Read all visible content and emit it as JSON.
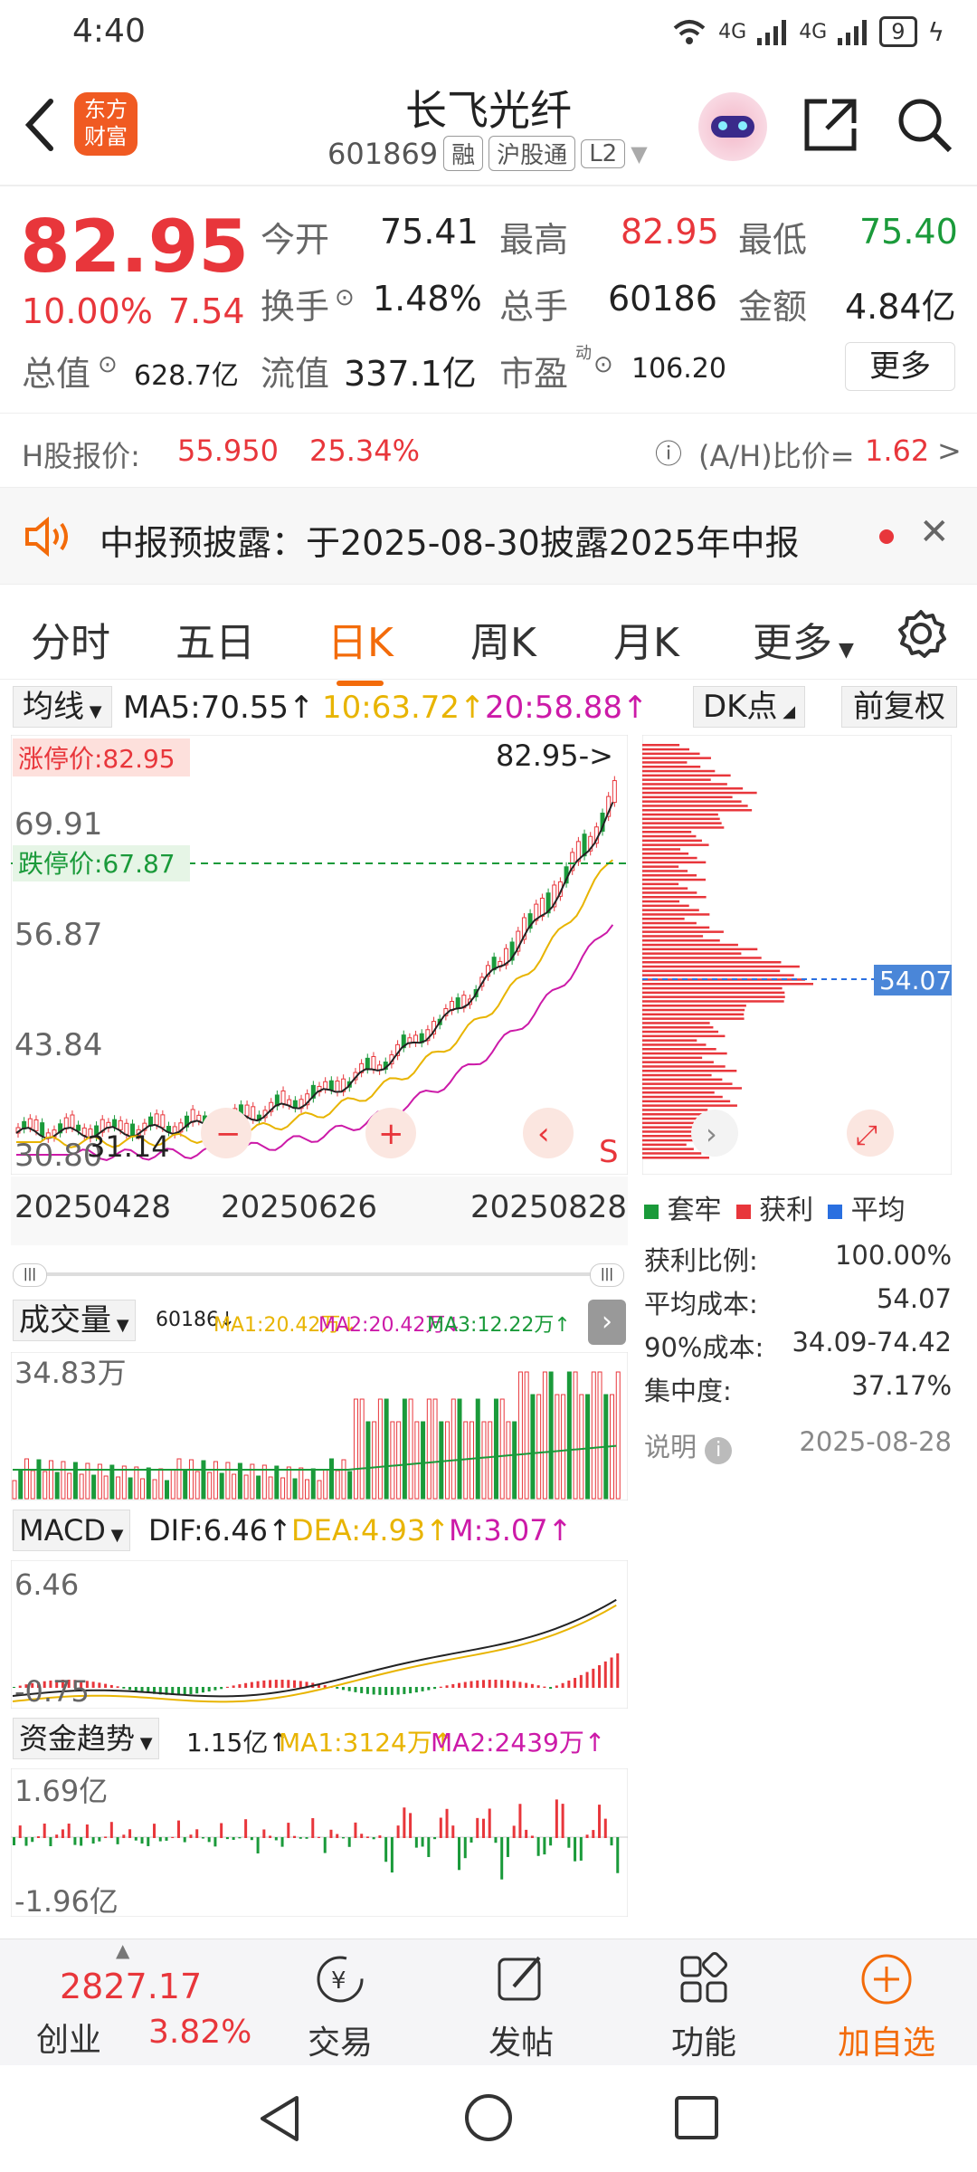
{
  "status_bar": {
    "time": "4:40",
    "net1": "4G",
    "net2": "4G",
    "battery": "9"
  },
  "header": {
    "title": "长飞光纤",
    "code": "601869",
    "tags": [
      "融",
      "沪股通",
      "L2"
    ],
    "logo_text": "东方财富"
  },
  "quote": {
    "price": "82.95",
    "change_pct": "10.00%",
    "change": "7.54",
    "open_label": "今开",
    "open": "75.41",
    "high_label": "最高",
    "high": "82.95",
    "low_label": "最低",
    "low": "75.40",
    "turnover_label": "换手",
    "turnover": "1.48%",
    "volume_label": "总手",
    "volume": "60186",
    "amount_label": "金额",
    "amount": "4.84亿",
    "mktcap_label": "总值",
    "mktcap": "628.7亿",
    "float_label": "流值",
    "float": "337.1亿",
    "pe_label": "市盈",
    "pe_sup": "动",
    "pe": "106.20",
    "more_label": "更多"
  },
  "h_share": {
    "label": "H股报价:",
    "price": "55.950",
    "pct": "25.34%",
    "ah_label": "(A/H)比价=",
    "ah": "1.62",
    "arrow": ">"
  },
  "notice": {
    "text": "中报预披露：于2025-08-30披露2025年中报",
    "close": "✕"
  },
  "tabs": [
    "分时",
    "五日",
    "日K",
    "周K",
    "月K",
    "更多"
  ],
  "active_tab": 2,
  "kline": {
    "indicator_label": "均线",
    "ma5": "MA5:70.55↑",
    "ma10": "10:63.72↑",
    "ma20": "20:58.88↑",
    "dk_label": "DK点",
    "adjust_label": "前复权",
    "limit_up": "涨停价:82.95",
    "limit_down": "跌停价:67.87",
    "last_price_tag": "82.95->",
    "y_labels": [
      "69.91",
      "56.87",
      "43.84",
      "30.80"
    ],
    "low_marker": "31.14",
    "x_labels": [
      "20250428",
      "20250626",
      "20250828"
    ],
    "cost_line": "54.07",
    "s_marker": "S"
  },
  "chip": {
    "legend": [
      "套牢",
      "获利",
      "平均"
    ],
    "rows": [
      {
        "label": "获利比例:",
        "value": "100.00%"
      },
      {
        "label": "平均成本:",
        "value": "54.07"
      },
      {
        "label": "90%成本:",
        "value": "34.09-74.42"
      },
      {
        "label": "集中度:",
        "value": "37.17%"
      }
    ],
    "note_label": "说明",
    "date": "2025-08-28"
  },
  "volume": {
    "label": "成交量",
    "vol": "60186↓",
    "ma1": "MA1:20.42万↓",
    "ma2": "MA2:20.42万↓",
    "ma3": "MA3:12.22万↑",
    "max_label": "34.83万"
  },
  "macd": {
    "label": "MACD",
    "dif": "DIF:6.46↑",
    "dea": "DEA:4.93↑",
    "m": "M:3.07↑",
    "top": "6.46",
    "bottom": "-0.75"
  },
  "capital": {
    "label": "资金趋势",
    "val": "1.15亿↑",
    "ma1": "MA1:3124万↑",
    "ma2": "MA2:2439万↑",
    "top": "1.69亿",
    "bottom": "-1.96亿"
  },
  "bottom_nav": {
    "index_value": "2827.17",
    "index_name": "创业",
    "index_pct": "3.82%",
    "items": [
      "交易",
      "发帖",
      "功能",
      "加自选"
    ]
  },
  "colors": {
    "up": "#e8363b",
    "down": "#1a9a3a",
    "accent": "#f36b0a"
  }
}
